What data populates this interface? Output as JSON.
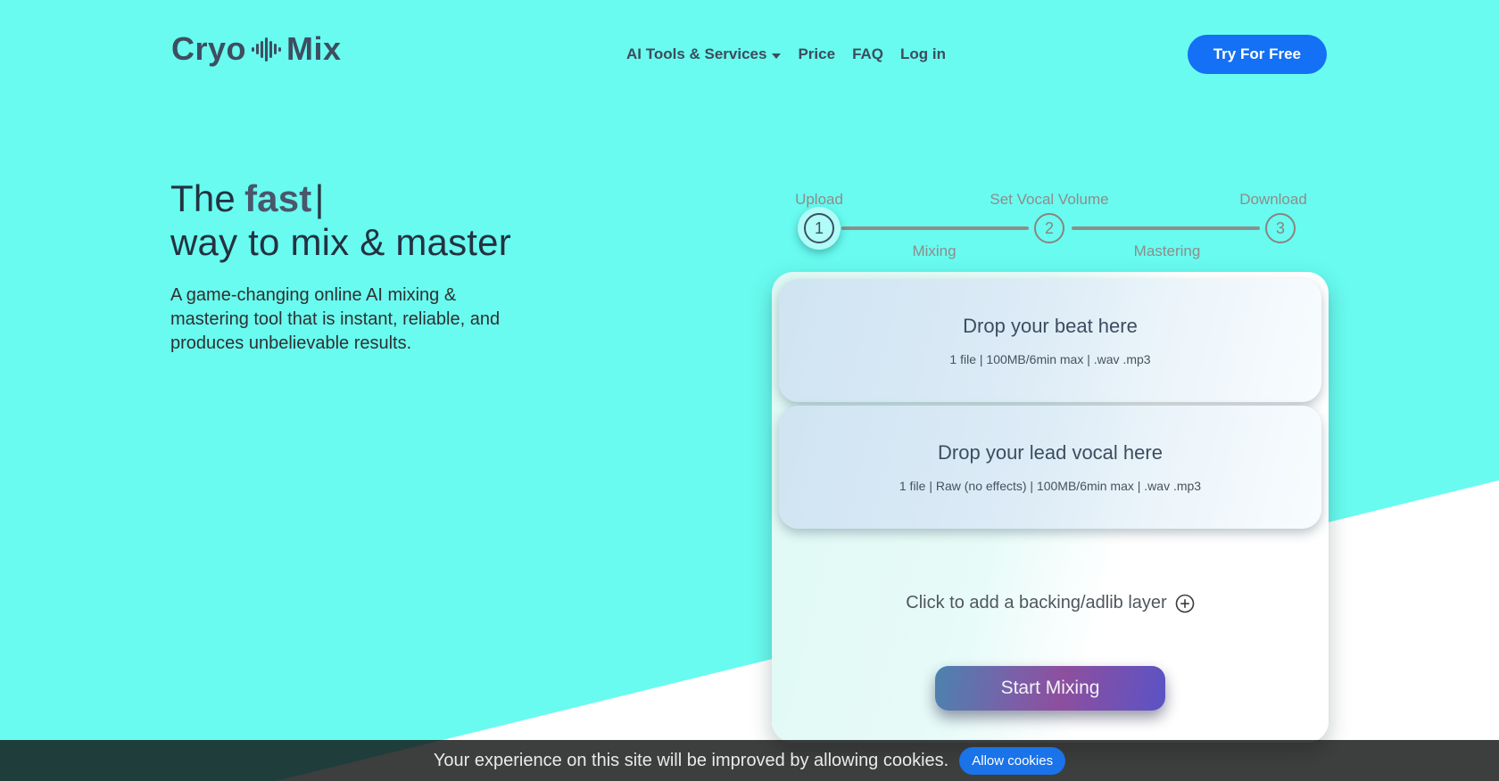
{
  "header": {
    "logo": {
      "word_left": "Cryo",
      "word_right": "Mix"
    },
    "nav": [
      {
        "label": "AI Tools & Services",
        "has_dropdown": true
      },
      {
        "label": "Price"
      },
      {
        "label": "FAQ"
      },
      {
        "label": "Log in"
      }
    ],
    "cta_label": "Try For Free"
  },
  "hero": {
    "title_prefix": "The",
    "title_highlight": "fast",
    "title_cursor": "|",
    "title_line2": "way to mix & master",
    "description": "A game-changing online AI mixing & mastering tool that is instant, reliable, and produces unbelievable results."
  },
  "stepper": {
    "steps": [
      {
        "number": "1",
        "label": "Upload",
        "active": true
      },
      {
        "number": "2",
        "label": "Set Vocal Volume",
        "active": false
      },
      {
        "number": "3",
        "label": "Download",
        "active": false
      }
    ],
    "segments": [
      {
        "label": "Mixing"
      },
      {
        "label": "Mastering"
      }
    ]
  },
  "uploader": {
    "dropzones": [
      {
        "title": "Drop your beat here",
        "specs": "1 file | 100MB/6min max | .wav .mp3"
      },
      {
        "title": "Drop your lead vocal here",
        "specs": "1 file | Raw (no effects) | 100MB/6min max | .wav .mp3"
      }
    ],
    "add_layer_label": "Click to add a backing/adlib layer",
    "add_layer_icon": "plus-circle-icon",
    "start_button_label": "Start Mixing"
  },
  "cookie_banner": {
    "message": "Your experience on this site will be improved by allowing cookies.",
    "button_label": "Allow cookies"
  },
  "colors": {
    "background_cyan": "#69fbf0",
    "brand_navy": "#3d4e60",
    "cta_blue": "#1470f4",
    "cookie_button_blue": "#1a73e8",
    "stepper_gray": "#8f8c8a",
    "start_gradient": [
      "#4b83af",
      "#8d4f9e",
      "#5b53c5"
    ]
  }
}
